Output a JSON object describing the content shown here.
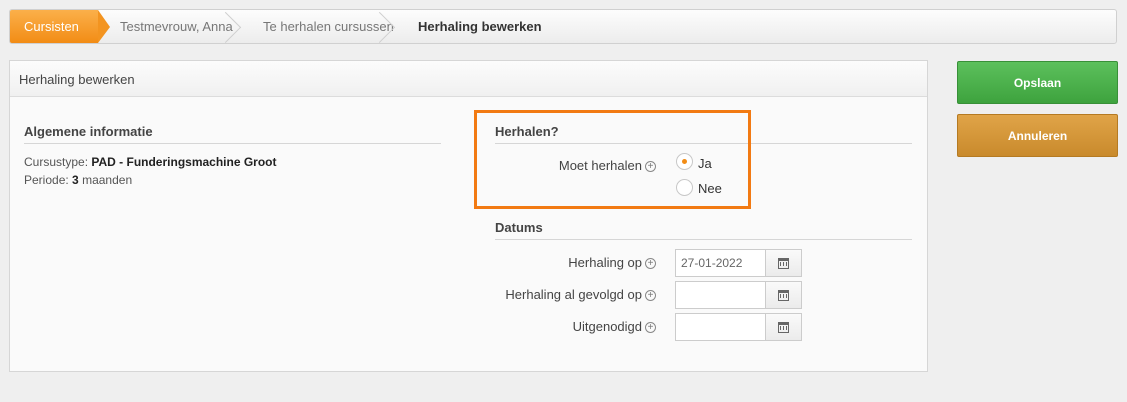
{
  "breadcrumb": {
    "items": [
      "Cursisten",
      "Testmevrouw, Anna",
      "Te herhalen cursussen",
      "Herhaling bewerken"
    ]
  },
  "panel": {
    "title": "Herhaling bewerken",
    "general": {
      "title": "Algemene informatie",
      "course_type_label": "Cursustype:",
      "course_type_value": "PAD - Funderingsmachine Groot",
      "period_label": "Periode:",
      "period_value": "3",
      "period_unit": "maanden"
    },
    "repeat": {
      "title": "Herhalen?",
      "must_repeat_label": "Moet herhalen",
      "options": [
        "Ja",
        "Nee"
      ],
      "selected": "Ja"
    },
    "dates": {
      "title": "Datums",
      "fields": [
        {
          "label": "Herhaling op",
          "value": "27-01-2022"
        },
        {
          "label": "Herhaling al gevolgd op",
          "value": ""
        },
        {
          "label": "Uitgenodigd",
          "value": ""
        }
      ]
    }
  },
  "actions": {
    "save_label": "Opslaan",
    "cancel_label": "Annuleren"
  },
  "colors": {
    "accent": "#f28c15",
    "save": "#4cb14c",
    "cancel": "#d4973a",
    "highlight": "#f27a12"
  }
}
